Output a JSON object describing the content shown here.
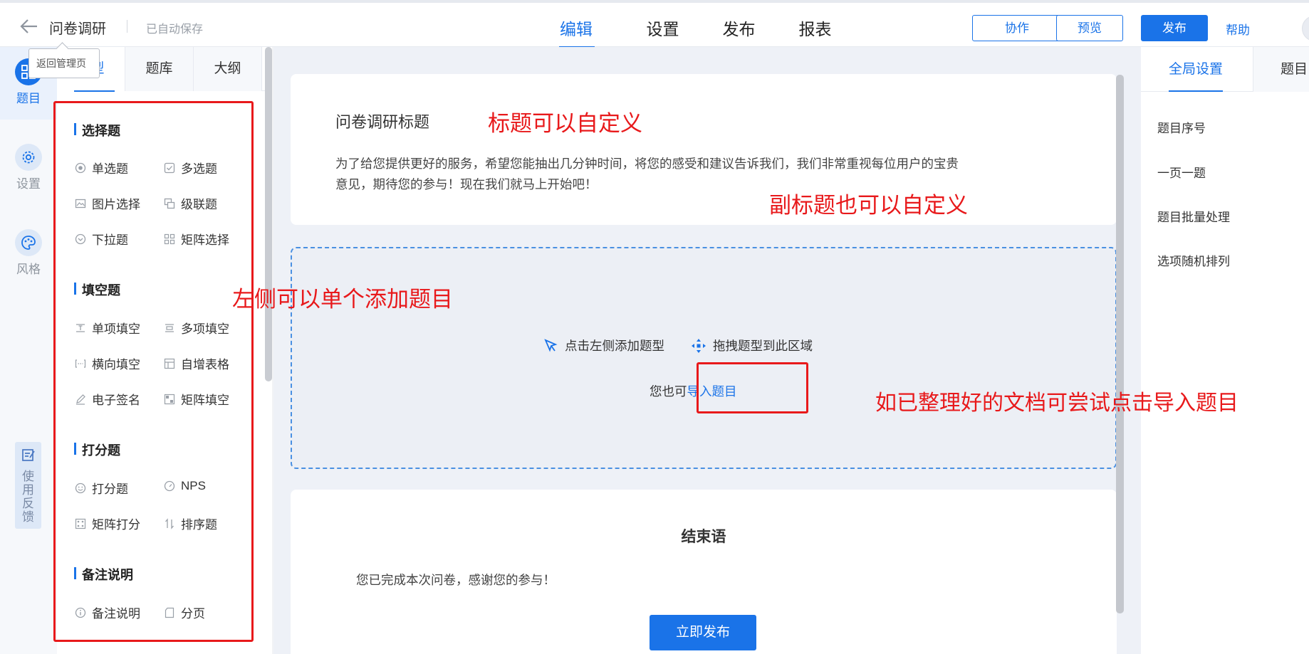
{
  "header": {
    "back_label": "问卷调研",
    "autosave": "已自动保存",
    "tooltip": "返回管理页",
    "tabs": [
      "编辑",
      "设置",
      "发布",
      "报表"
    ],
    "cooperate": "协作",
    "preview": "预览",
    "publish": "发布",
    "help": "帮助"
  },
  "rail": {
    "items": [
      {
        "label": "题目",
        "icon": "grid-icon"
      },
      {
        "label": "设置",
        "icon": "gear-icon"
      },
      {
        "label": "风格",
        "icon": "palette-icon"
      }
    ],
    "feedback": "使用反馈"
  },
  "left_panel": {
    "tabs": [
      "题型",
      "题库",
      "大纲"
    ],
    "groups": [
      {
        "title": "选择题",
        "items": [
          "单选题",
          "多选题",
          "图片选择",
          "级联题",
          "下拉题",
          "矩阵选择"
        ]
      },
      {
        "title": "填空题",
        "items": [
          "单项填空",
          "多项填空",
          "横向填空",
          "自增表格",
          "电子签名",
          "矩阵填空"
        ]
      },
      {
        "title": "打分题",
        "items": [
          "打分题",
          "NPS",
          "矩阵打分",
          "排序题"
        ]
      },
      {
        "title": "备注说明",
        "items": [
          "备注说明",
          "分页"
        ]
      }
    ]
  },
  "survey": {
    "title": "问卷调研标题",
    "subtitle": "为了给您提供更好的服务，希望您能抽出几分钟时间，将您的感受和建议告诉我们，我们非常重视每位用户的宝贵意见，期待您的参与！现在我们就马上开始吧！",
    "dropzone": {
      "click_hint": "点击左侧添加题型",
      "drag_hint": "拖拽题型到此区域",
      "import_prefix": "您也可",
      "import_link": "导入题目"
    },
    "end": {
      "title": "结束语",
      "text": "您已完成本次问卷，感谢您的参与！",
      "publish_now": "立即发布"
    }
  },
  "right_panel": {
    "tabs": [
      "全局设置",
      "题目"
    ],
    "items": [
      "题目序号",
      "一页一题",
      "题目批量处理",
      "选项随机排列"
    ]
  },
  "annotations": {
    "title_custom": "标题可以自定义",
    "subtitle_custom": "副标题也可以自定义",
    "left_add": "左侧可以单个添加题目",
    "import_tip": "如已整理好的文档可尝试点击导入题目"
  },
  "colors": {
    "accent": "#1a73e8",
    "annotation": "#e8191b"
  }
}
